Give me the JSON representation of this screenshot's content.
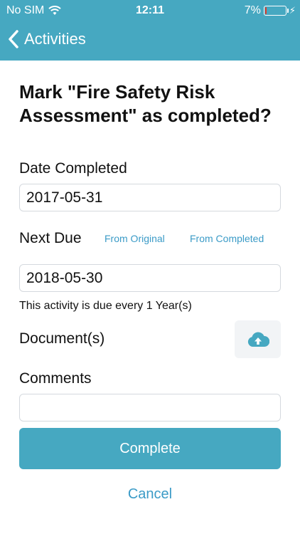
{
  "status_bar": {
    "carrier": "No SIM",
    "time": "12:11",
    "battery_percent": "7%",
    "battery_level": 0.07,
    "wifi_icon": "wifi-icon",
    "charging_icon": "bolt-icon"
  },
  "nav": {
    "back_label": "Activities",
    "back_icon": "chevron-left-icon",
    "bar_color": "#46a8c1"
  },
  "form": {
    "title": "Mark \"Fire Safety Risk Assessment\" as completed?",
    "date_completed_label": "Date Completed",
    "date_completed_value": "2017-05-31",
    "next_due_label": "Next Due",
    "from_original_label": "From Original",
    "from_completed_label": "From Completed",
    "next_due_value": "2018-05-30",
    "due_hint": "This activity is due every 1 Year(s)",
    "documents_label": "Document(s)",
    "upload_icon": "cloud-upload-icon",
    "comments_label": "Comments",
    "comments_value": "",
    "complete_label": "Complete",
    "cancel_label": "Cancel",
    "accent_color": "#46a8c1",
    "link_color": "#3b9bc7"
  }
}
